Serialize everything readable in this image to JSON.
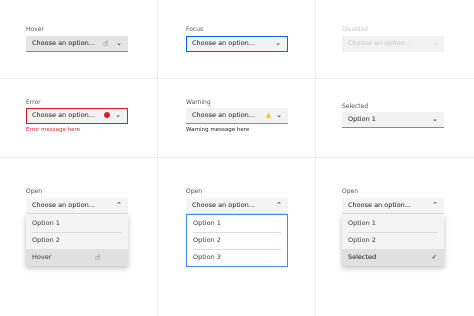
{
  "states": {
    "hover": {
      "label": "Hover",
      "placeholder": "Choose an option..."
    },
    "focus": {
      "label": "Focus",
      "placeholder": "Choose an option..."
    },
    "disabled": {
      "label": "Disabled",
      "placeholder": "Choose an option..."
    },
    "error": {
      "label": "Error",
      "placeholder": "Choose an option...",
      "message": "Error message here"
    },
    "warning": {
      "label": "Warning",
      "placeholder": "Choose an option...",
      "message": "Warning message here"
    },
    "selected": {
      "label": "Selected",
      "value": "Option 1"
    },
    "open_hover": {
      "label": "Open",
      "placeholder": "Choose an option...",
      "options": [
        "Option 1",
        "Option 2",
        "Hover"
      ]
    },
    "open_focus": {
      "label": "Open",
      "placeholder": "Choose an option...",
      "options": [
        "Option 1",
        "Option 2",
        "Option 3"
      ]
    },
    "open_selected": {
      "label": "Open",
      "placeholder": "Choose an option...",
      "options": [
        "Option 1",
        "Option 2",
        "Selected"
      ]
    }
  },
  "icons": {
    "chevron_down": "chevron-down-icon",
    "chevron_up": "chevron-up-icon",
    "error": "error-filled-icon",
    "warning": "warning-filled-icon",
    "check": "checkmark-icon",
    "cursor": "hand-cursor-icon"
  },
  "colors": {
    "field_bg": "#f2f2f2",
    "focus": "#0f62fe",
    "error": "#da1e28",
    "warning": "#f1c21b",
    "disabled_text": "#c6c6c6"
  }
}
